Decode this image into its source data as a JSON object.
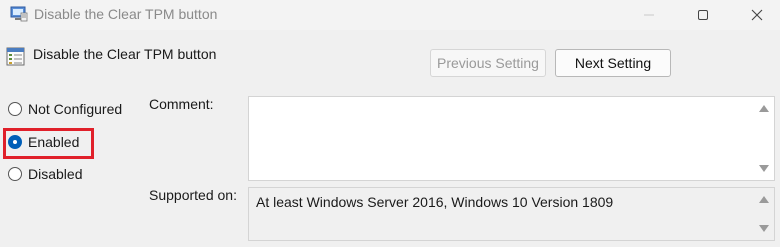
{
  "window": {
    "title": "Disable the Clear TPM button",
    "icons": {
      "app": "policy-app-icon",
      "minimize": "minimize-icon",
      "maximize": "maximize-icon",
      "close": "close-icon"
    }
  },
  "header": {
    "title": "Disable the Clear TPM button",
    "icon": "policy-setting-icon"
  },
  "nav": {
    "previous_label": "Previous Setting",
    "next_label": "Next Setting",
    "previous_enabled": false
  },
  "state": {
    "options": [
      {
        "label": "Not Configured",
        "checked": false
      },
      {
        "label": "Enabled",
        "checked": true
      },
      {
        "label": "Disabled",
        "checked": false
      }
    ],
    "highlight_color": "#e0202a"
  },
  "comment": {
    "label": "Comment:",
    "value": ""
  },
  "supported": {
    "label": "Supported on:",
    "value": "At least Windows Server 2016, Windows 10 Version 1809"
  },
  "colors": {
    "accent": "#005fb8",
    "background": "#f0f0f0"
  }
}
